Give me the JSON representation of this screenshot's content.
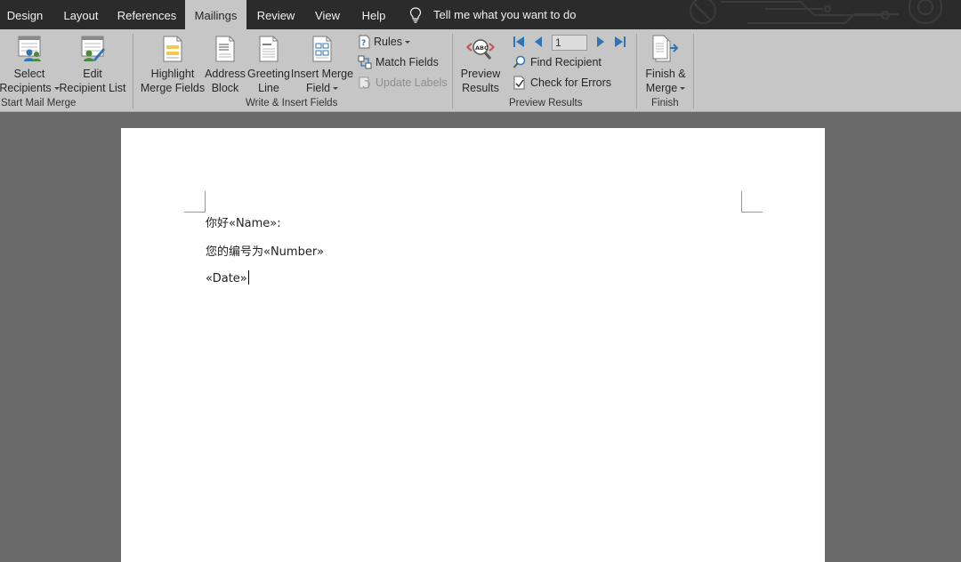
{
  "tabs": [
    {
      "label": "Design",
      "active": false
    },
    {
      "label": "Layout",
      "active": false
    },
    {
      "label": "References",
      "active": false
    },
    {
      "label": "Mailings",
      "active": true
    },
    {
      "label": "Review",
      "active": false
    },
    {
      "label": "View",
      "active": false
    },
    {
      "label": "Help",
      "active": false
    }
  ],
  "tell_me": "Tell me what you want to do",
  "ribbon": {
    "start_mail_merge": {
      "group_label": "Start Mail Merge",
      "select_recipients": [
        "Select",
        "Recipients"
      ],
      "edit_recipient_list": [
        "Edit",
        "Recipient List"
      ]
    },
    "write_insert": {
      "group_label": "Write & Insert Fields",
      "highlight_merge_fields": [
        "Highlight",
        "Merge Fields"
      ],
      "address_block": [
        "Address",
        "Block"
      ],
      "greeting_line": [
        "Greeting",
        "Line"
      ],
      "insert_merge_field": [
        "Insert Merge",
        "Field"
      ],
      "rules": "Rules",
      "match_fields": "Match Fields",
      "update_labels": "Update Labels"
    },
    "preview_results": {
      "group_label": "Preview Results",
      "preview_results_btn": [
        "Preview",
        "Results"
      ],
      "record_number": "1",
      "find_recipient": "Find Recipient",
      "check_for_errors": "Check for Errors"
    },
    "finish": {
      "group_label": "Finish",
      "finish_merge": [
        "Finish &",
        "Merge"
      ]
    }
  },
  "document": {
    "lines": [
      "你好«Name»:",
      "您的编号为«Number»",
      "«Date»"
    ]
  },
  "colors": {
    "tabbar_bg": "#2b2b2b",
    "ribbon_bg": "#c6c6c6",
    "workspace_bg": "#6a6a6a",
    "accent_blue": "#2e75b6"
  }
}
